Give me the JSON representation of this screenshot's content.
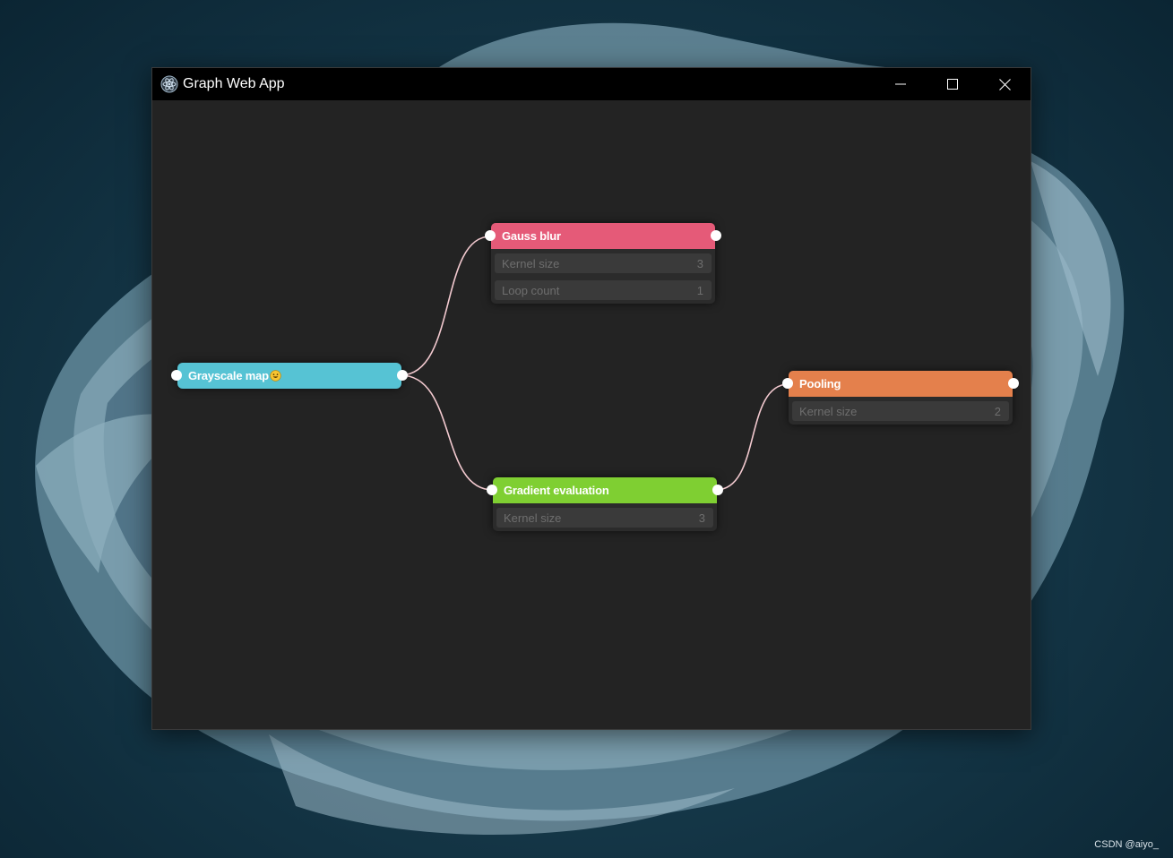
{
  "window": {
    "title": "Graph Web App"
  },
  "nodes": {
    "grayscale": {
      "title": "Grayscale map",
      "color": "#56c3d4"
    },
    "gauss": {
      "title": "Gauss blur",
      "color": "#e55a78",
      "params": [
        {
          "label": "Kernel size",
          "value": "3"
        },
        {
          "label": "Loop count",
          "value": "1"
        }
      ]
    },
    "gradient": {
      "title": "Gradient evaluation",
      "color": "#7fcf32",
      "params": [
        {
          "label": "Kernel size",
          "value": "3"
        }
      ]
    },
    "pooling": {
      "title": "Pooling",
      "color": "#e4804c",
      "params": [
        {
          "label": "Kernel size",
          "value": "2"
        }
      ]
    }
  },
  "connections": [
    {
      "from": "Grayscale map",
      "to": "Gauss blur"
    },
    {
      "from": "Grayscale map",
      "to": "Gradient evaluation"
    },
    {
      "from": "Gradient evaluation",
      "to": "Pooling"
    }
  ],
  "wire_color": "#f2c9cf",
  "watermark": "CSDN @aiyo_"
}
